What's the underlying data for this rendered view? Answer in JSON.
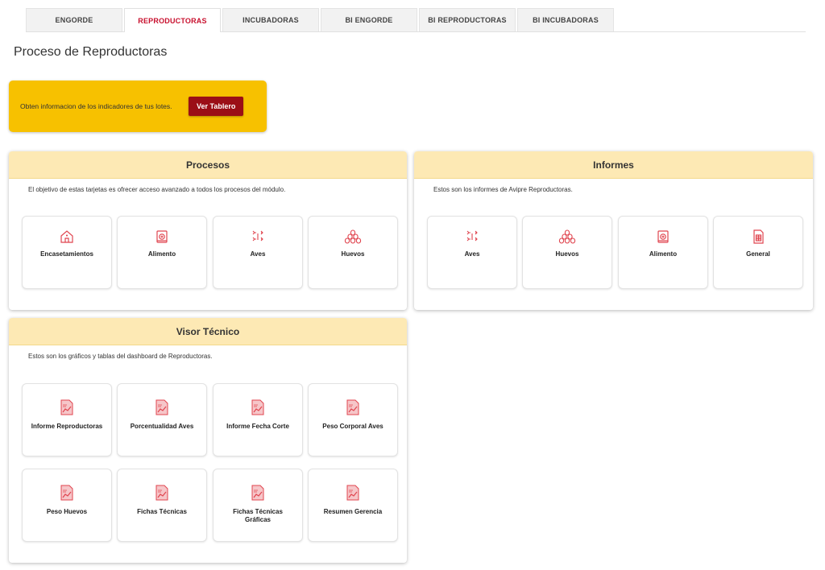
{
  "tabs": [
    {
      "label": "ENGORDE",
      "active": false
    },
    {
      "label": "REPRODUCTORAS",
      "active": true
    },
    {
      "label": "INCUBADORAS",
      "active": false
    },
    {
      "label": "BI ENGORDE",
      "active": false
    },
    {
      "label": "BI REPRODUCTORAS",
      "active": false
    },
    {
      "label": "BI INCUBADORAS",
      "active": false
    }
  ],
  "page_title": "Proceso de Reproductoras",
  "banner": {
    "text": "Obten informacion de los indicadores de tus lotes.",
    "button_label": "Ver Tablero"
  },
  "procesos": {
    "title": "Procesos",
    "description": "El objetivo de estas tarjetas es ofrecer acceso avanzado a todos los procesos del módulo.",
    "cards": [
      {
        "label": "Encasetamientos",
        "icon": "house-icon"
      },
      {
        "label": "Alimento",
        "icon": "feed-bag-icon"
      },
      {
        "label": "Aves",
        "icon": "birds-icon"
      },
      {
        "label": "Huevos",
        "icon": "eggs-icon"
      }
    ]
  },
  "informes": {
    "title": "Informes",
    "description": "Estos son los informes de Avipre Reproductoras.",
    "cards": [
      {
        "label": "Aves",
        "icon": "birds-icon"
      },
      {
        "label": "Huevos",
        "icon": "eggs-icon"
      },
      {
        "label": "Alimento",
        "icon": "feed-bag-icon"
      },
      {
        "label": "General",
        "icon": "report-document-icon"
      }
    ]
  },
  "visor": {
    "title": "Visor Técnico",
    "description": "Estos son los gráficos y tablas del dashboard de Reproductoras.",
    "cards": [
      {
        "label": "Informe Reproductoras",
        "icon": "chart-report-icon"
      },
      {
        "label": "Porcentualidad Aves",
        "icon": "chart-report-icon"
      },
      {
        "label": "Informe Fecha Corte",
        "icon": "chart-report-icon"
      },
      {
        "label": "Peso Corporal Aves",
        "icon": "chart-report-icon"
      },
      {
        "label": "Peso Huevos",
        "icon": "chart-report-icon"
      },
      {
        "label": "Fichas Técnicas",
        "icon": "chart-report-icon"
      },
      {
        "label": "Fichas Técnicas Gráficas",
        "icon": "chart-report-icon"
      },
      {
        "label": "Resumen Gerencia",
        "icon": "chart-report-icon"
      }
    ]
  },
  "colors": {
    "accent_red": "#c8102e",
    "button_red": "#9b0e16",
    "banner_yellow": "#f7c100",
    "panel_header": "#fde9b4",
    "icon_red": "#e0454f"
  }
}
